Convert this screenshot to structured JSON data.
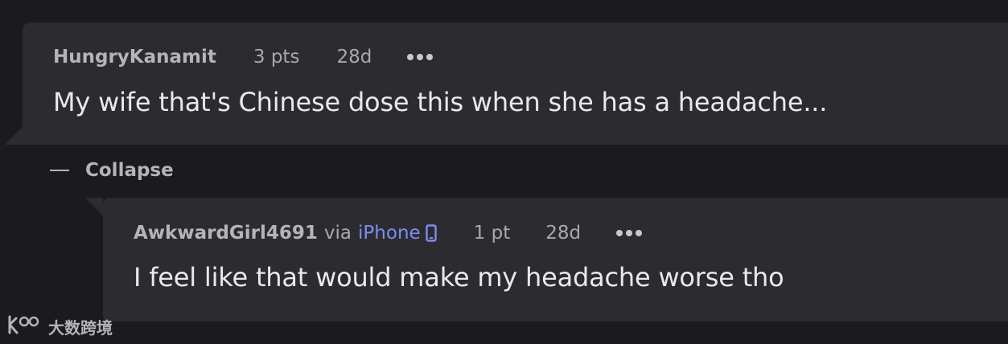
{
  "comments": [
    {
      "username": "HungryKanamit",
      "points": "3 pts",
      "age": "28d",
      "body": "My wife that's Chinese dose this when she has a headache..."
    },
    {
      "username": "AwkwardGirl4691",
      "via": "via",
      "platform": "iPhone",
      "points": "1 pt",
      "age": "28d",
      "body": "I feel like that would make my headache worse tho"
    }
  ],
  "collapse": {
    "label": "Collapse"
  },
  "watermark": {
    "logo": "k00",
    "text": "大数跨境"
  },
  "icons": {
    "more": "more-dots-icon",
    "phone": "smartphone-icon",
    "collapse": "minus-icon"
  },
  "colors": {
    "background": "#1b1a1f",
    "card": "#2c2c30",
    "platform_link": "#7d8cf0",
    "text": "#e9e9ec",
    "meta": "#a8a8ad"
  }
}
